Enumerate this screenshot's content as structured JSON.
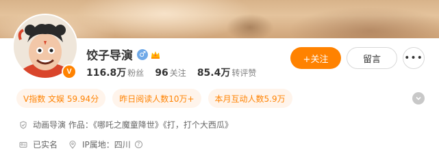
{
  "profile": {
    "name": "饺子导演",
    "verified_mark": "V",
    "gender_symbol": "♂",
    "badges": [
      "male-icon",
      "crown-icon"
    ],
    "stats": [
      {
        "value": "116.8万",
        "label": "粉丝"
      },
      {
        "value": "96",
        "label": "关注"
      },
      {
        "value": "85.4万",
        "label": "转评赞"
      }
    ]
  },
  "actions": {
    "follow_label": "+关注",
    "message_label": "留言",
    "more_label": "•••"
  },
  "tags": [
    "V指数 文娱 59.94分",
    "昨日阅读人数10万+",
    "本月互动人数5.9万"
  ],
  "info": {
    "description": "动画导演 作品：《哪吒之魔童降世》《打，打个大西瓜》",
    "real_name": "已实名",
    "ip_location": "IP属地：四川",
    "help_symbol": "?"
  },
  "colors": {
    "accent": "#ff8200",
    "tag_bg": "#fff4eb",
    "gender": "#6fa9e8"
  }
}
